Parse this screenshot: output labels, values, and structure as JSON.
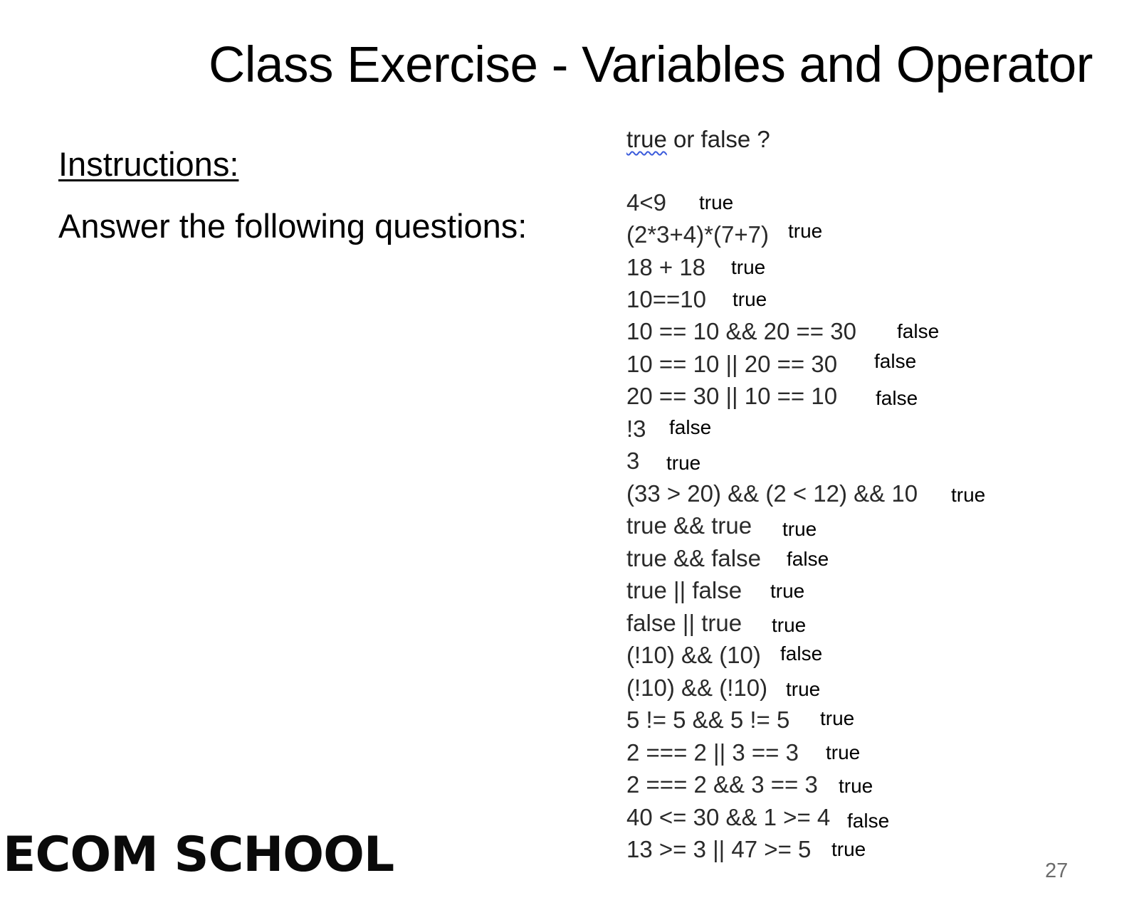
{
  "slide": {
    "title": "Class Exercise - Variables and Operator",
    "page_number": "27"
  },
  "instructions": {
    "heading": "Instructions:",
    "body": "Answer the following questions:"
  },
  "quiz": {
    "prompt_word": "true",
    "prompt_rest": " or false ?",
    "items": [
      {
        "expression": " 4<9",
        "answer": "true"
      },
      {
        "expression": "(2*3+4)*(7+7)",
        "answer": "true"
      },
      {
        "expression": "18 + 18",
        "answer": "true"
      },
      {
        "expression": "10==10",
        "answer": "true"
      },
      {
        "expression": "10 == 10 && 20 == 30",
        "answer": "false"
      },
      {
        "expression": "10 == 10 || 20 == 30",
        "answer": "false"
      },
      {
        "expression": "20 == 30 || 10 == 10",
        "answer": "false"
      },
      {
        "expression": "!3",
        "answer": "false"
      },
      {
        "expression": "3",
        "answer": "true"
      },
      {
        "expression": "(33 > 20) && (2 < 12) && 10",
        "answer": "true"
      },
      {
        "expression": "true && true",
        "answer": "true"
      },
      {
        "expression": "true && false",
        "answer": "false"
      },
      {
        "expression": "true || false",
        "answer": "true"
      },
      {
        "expression": "false || true",
        "answer": "true"
      },
      {
        "expression": "(!10) && (10)",
        "answer": "false"
      },
      {
        "expression": "(!10) && (!10)",
        "answer": "true"
      },
      {
        "expression": "5 != 5 &&  5 != 5",
        "answer": "true"
      },
      {
        "expression": "2 === 2 || 3 == 3",
        "answer": "true"
      },
      {
        "expression": "2 === 2 && 3 == 3",
        "answer": "true"
      },
      {
        "expression": "40 <= 30 && 1 >= 4",
        "answer": "false"
      },
      {
        "expression": "13 >= 3 || 47 >= 5",
        "answer": "true"
      }
    ]
  },
  "logo": {
    "text": "ECOM SCHOOL"
  }
}
